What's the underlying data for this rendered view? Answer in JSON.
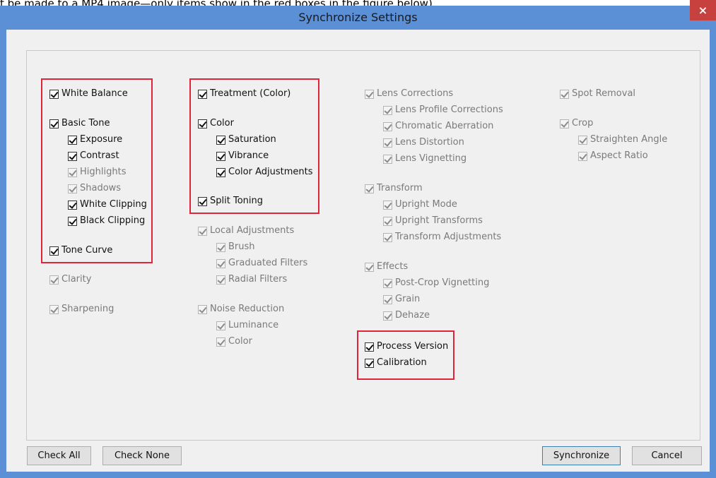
{
  "doc": {
    "text": "t be made to a MP4 image—only items show in the red boxes in the figure below)."
  },
  "window": {
    "title": "Synchronize Settings",
    "close": "×"
  },
  "columns": [
    [
      {
        "label": "White Balance",
        "enabled": true
      },
      {
        "label": "Basic Tone",
        "enabled": true
      },
      {
        "label": "Exposure",
        "enabled": true
      },
      {
        "label": "Contrast",
        "enabled": true
      },
      {
        "label": "Highlights",
        "enabled": false
      },
      {
        "label": "Shadows",
        "enabled": false
      },
      {
        "label": "White Clipping",
        "enabled": true
      },
      {
        "label": "Black Clipping",
        "enabled": true
      },
      {
        "label": "Tone Curve",
        "enabled": true
      },
      {
        "label": "Clarity",
        "enabled": false
      },
      {
        "label": "Sharpening",
        "enabled": false
      }
    ],
    [
      {
        "label": "Treatment (Color)",
        "enabled": true
      },
      {
        "label": "Color",
        "enabled": true
      },
      {
        "label": "Saturation",
        "enabled": true
      },
      {
        "label": "Vibrance",
        "enabled": true
      },
      {
        "label": "Color Adjustments",
        "enabled": true
      },
      {
        "label": "Split Toning",
        "enabled": true
      },
      {
        "label": "Local Adjustments",
        "enabled": false
      },
      {
        "label": "Brush",
        "enabled": false
      },
      {
        "label": "Graduated Filters",
        "enabled": false
      },
      {
        "label": "Radial Filters",
        "enabled": false
      },
      {
        "label": "Noise Reduction",
        "enabled": false
      },
      {
        "label": "Luminance",
        "enabled": false
      },
      {
        "label": "Color",
        "enabled": false
      }
    ],
    [
      {
        "label": "Lens Corrections",
        "enabled": false
      },
      {
        "label": "Lens Profile Corrections",
        "enabled": false
      },
      {
        "label": "Chromatic Aberration",
        "enabled": false
      },
      {
        "label": "Lens Distortion",
        "enabled": false
      },
      {
        "label": "Lens Vignetting",
        "enabled": false
      },
      {
        "label": "Transform",
        "enabled": false
      },
      {
        "label": "Upright Mode",
        "enabled": false
      },
      {
        "label": "Upright Transforms",
        "enabled": false
      },
      {
        "label": "Transform Adjustments",
        "enabled": false
      },
      {
        "label": "Effects",
        "enabled": false
      },
      {
        "label": "Post-Crop Vignetting",
        "enabled": false
      },
      {
        "label": "Grain",
        "enabled": false
      },
      {
        "label": "Dehaze",
        "enabled": false
      },
      {
        "label": "Process Version",
        "enabled": true
      },
      {
        "label": "Calibration",
        "enabled": true
      }
    ],
    [
      {
        "label": "Spot Removal",
        "enabled": false
      },
      {
        "label": "Crop",
        "enabled": false
      },
      {
        "label": "Straighten Angle",
        "enabled": false
      },
      {
        "label": "Aspect Ratio",
        "enabled": false
      }
    ]
  ],
  "buttons": {
    "check_all": "Check All",
    "check_none": "Check None",
    "synchronize": "Synchronize",
    "cancel": "Cancel"
  },
  "colors": {
    "titlebar": "#5b8fd6",
    "close": "#c7413e",
    "highlight": "#e0243a"
  }
}
